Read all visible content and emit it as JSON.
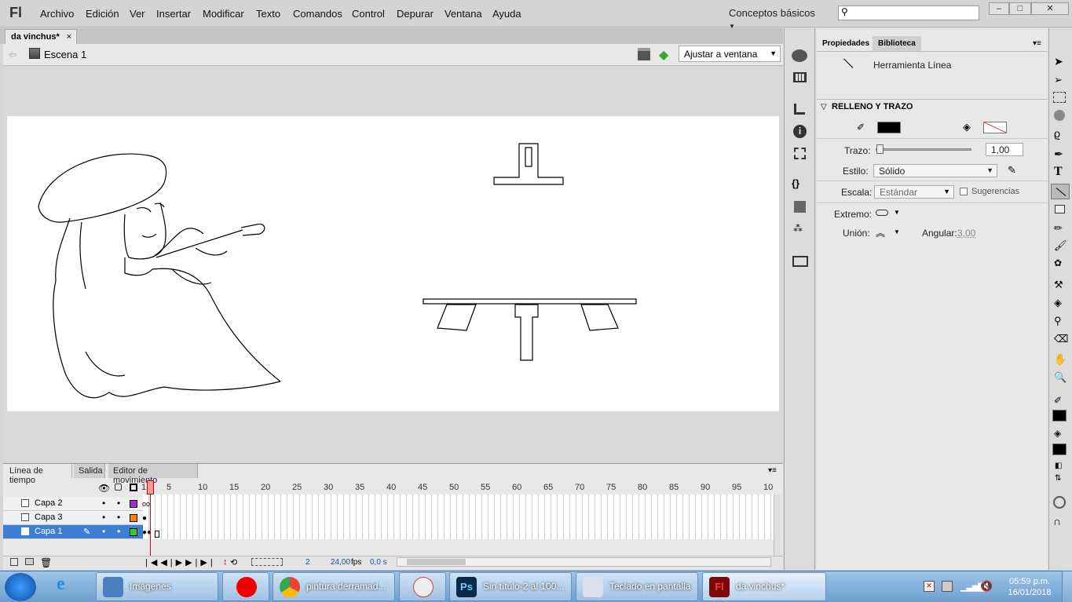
{
  "app": {
    "logo": "Fl"
  },
  "menu": [
    "Archivo",
    "Edición",
    "Ver",
    "Insertar",
    "Modificar",
    "Texto",
    "Comandos",
    "Control",
    "Depurar",
    "Ventana",
    "Ayuda"
  ],
  "workspace": "Conceptos básicos",
  "document": {
    "tab": "da vinchus*",
    "scene": "Escena 1",
    "zoom": "Ajustar a ventana"
  },
  "timeline": {
    "tabs": [
      "Línea de tiempo",
      "Salida",
      "Editor de movimiento"
    ],
    "ruler": [
      "1",
      "5",
      "10",
      "15",
      "20",
      "25",
      "30",
      "35",
      "40",
      "45",
      "50",
      "55",
      "60",
      "65",
      "70",
      "75",
      "80",
      "85",
      "90",
      "95",
      "10"
    ],
    "layers": [
      {
        "name": "Capa 2",
        "color": "#9b30d0"
      },
      {
        "name": "Capa 3",
        "color": "#ff7f00"
      },
      {
        "name": "Capa 1",
        "color": "#33cc33"
      }
    ],
    "current_frame": "2",
    "fps": "24,00",
    "fps_unit": "fps",
    "time": "0,0 s"
  },
  "properties": {
    "tabs": [
      "Propiedades",
      "Biblioteca"
    ],
    "tool_name": "Herramienta Línea",
    "section": "RELLENO Y TRAZO",
    "stroke_label": "Trazo:",
    "stroke_value": "1,00",
    "style_label": "Estilo:",
    "style_value": "Sólido",
    "scale_label": "Escala:",
    "scale_value": "Estándar",
    "hints_label": "Sugerencias",
    "cap_label": "Extremo:",
    "join_label": "Unión:",
    "miter_label": "Angular:",
    "miter_value": "3,00",
    "stroke_color": "#000000",
    "fill_color": "none"
  },
  "taskbar": {
    "items": [
      "Imágenes",
      "",
      "pintura derramad...",
      "",
      "Sin título-2 al 100...",
      "Teclado en pantalla",
      "da vinchus*"
    ],
    "time": "05:59 p.m.",
    "date": "16/01/2018"
  }
}
